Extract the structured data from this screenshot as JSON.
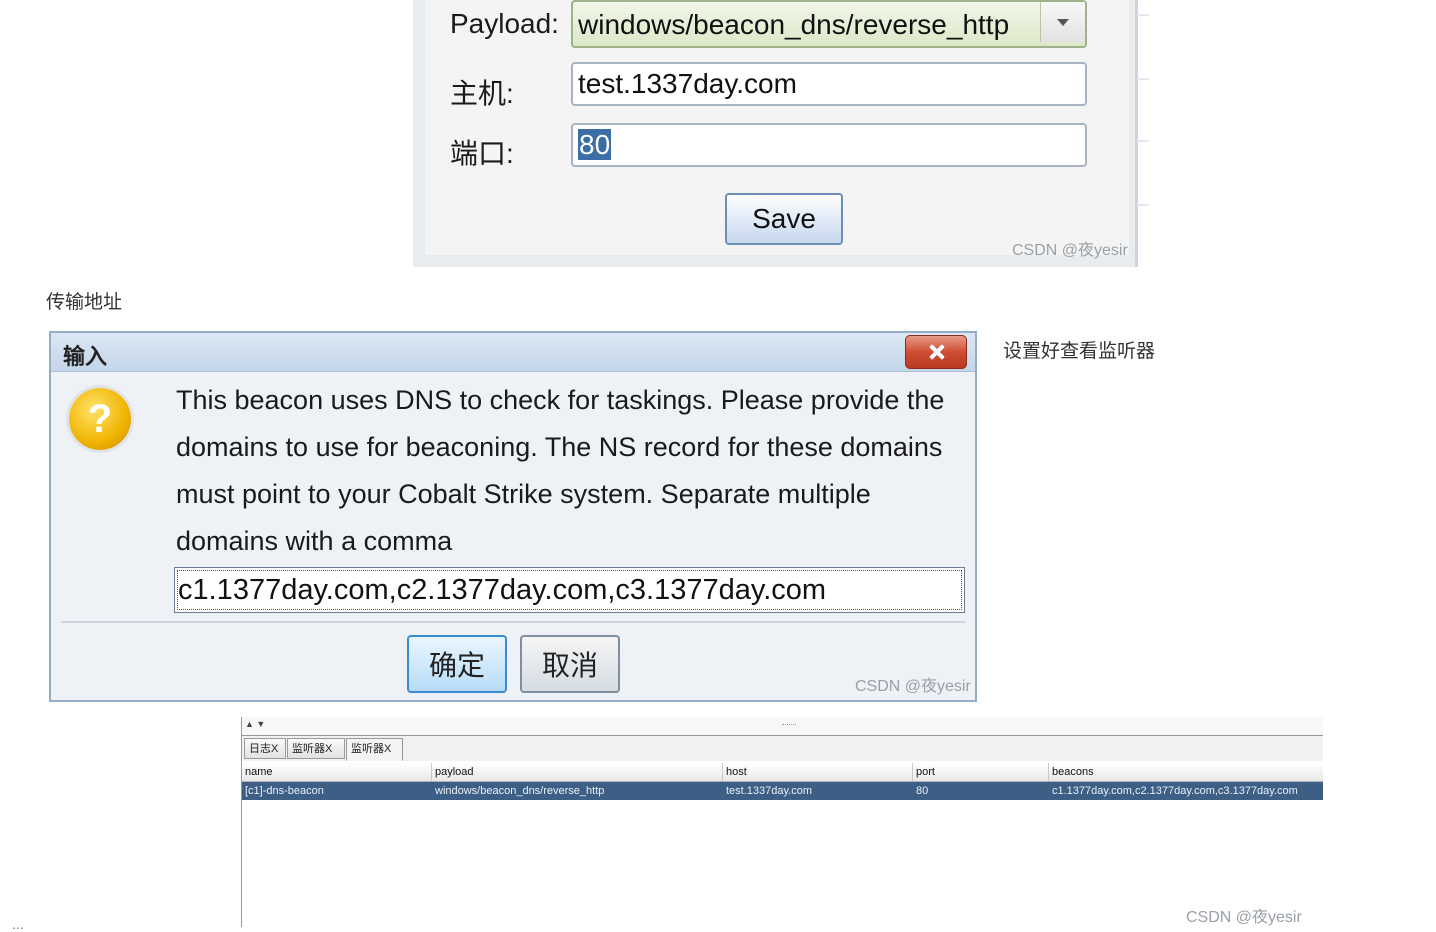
{
  "form": {
    "payload_label": "Payload:",
    "payload_value": "windows/beacon_dns/reverse_http",
    "host_label": "主机:",
    "host_value": "test.1337day.com",
    "port_label": "端口:",
    "port_value": "80",
    "save_label": "Save",
    "watermark": "CSDN @夜yesir"
  },
  "captions": {
    "transfer_address": "传输地址",
    "after_setup": "设置好查看监听器",
    "bottom_fragment": "..."
  },
  "dialog": {
    "title": "输入",
    "icon": "question-icon",
    "message_lines": [
      "This beacon uses DNS to check for taskings. Please provide the",
      "domains to use for beaconing. The NS record for these domains",
      "must point to your Cobalt Strike system. Separate multiple",
      "domains with a comma"
    ],
    "input_value": "c1.1377day.com,c2.1377day.com,c3.1377day.com",
    "confirm_label": "确定",
    "cancel_label": "取消",
    "watermark": "CSDN @夜yesir",
    "close_color": "#cf4d33"
  },
  "listeners": {
    "top_arrows": "▲ ▼",
    "tabs": [
      "日志X",
      "监听器X",
      "监听器X"
    ],
    "active_tab": 2,
    "columns": [
      "name",
      "payload",
      "host",
      "port",
      "beacons"
    ],
    "rows": [
      [
        "[c1]-dns-beacon",
        "windows/beacon_dns/reverse_http",
        "test.1337day.com",
        "80",
        "c1.1377day.com,c2.1377day.com,c3.1377day.com"
      ]
    ],
    "selected_row_color": "#3d5f86",
    "watermark": "CSDN @夜yesir"
  }
}
